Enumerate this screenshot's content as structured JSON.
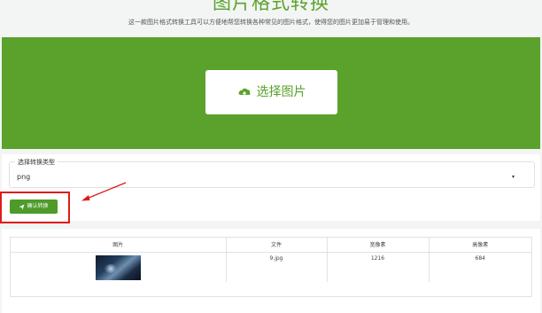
{
  "header": {
    "title": "图片格式转换",
    "subtitle": "这一款图片格式转换工具可以方便地帮您转换各种常见的图片格式，使得您的图片更加易于管理和使用。"
  },
  "upload": {
    "select_label": "选择图片",
    "accent": "#5aa22c"
  },
  "form": {
    "legend": "选择转换类型",
    "selected_format": "png",
    "caret": "▾",
    "confirm_label": "确认转换"
  },
  "table": {
    "headers": [
      "图片",
      "文件",
      "宽像素",
      "高像素"
    ],
    "rows": [
      {
        "file": "9.jpg",
        "width": "1216",
        "height": "684"
      }
    ]
  },
  "annotation": {
    "color": "#e01a1a"
  }
}
